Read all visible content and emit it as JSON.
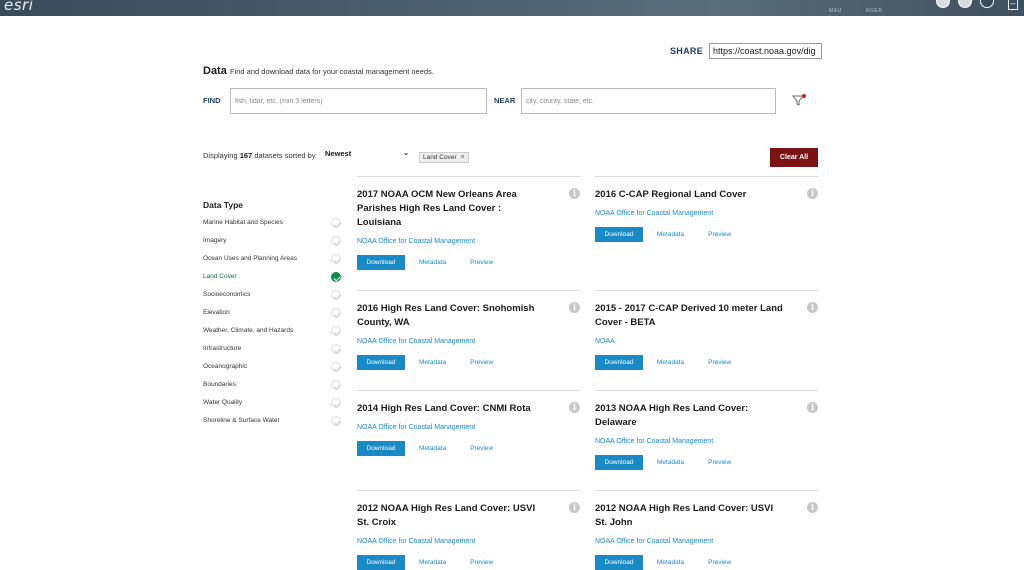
{
  "topbar": {
    "logo": "esri",
    "map_labels": [
      "MAU",
      "NGER"
    ]
  },
  "share": {
    "label": "SHARE",
    "url": "https://coast.noaa.gov/dig"
  },
  "header": {
    "title": "Data",
    "subtitle": "Find and download data for your coastal management needs."
  },
  "search": {
    "find_label": "FIND",
    "find_placeholder": "fish, lidar, etc. (min 3 letters)",
    "near_label": "NEAR",
    "near_placeholder": "city, county, state, etc."
  },
  "results": {
    "prefix": "Displaying",
    "count": "167",
    "suffix": "datasets sorted by",
    "sort_value": "Newest",
    "active_filter": "Land Cover",
    "chip_close": "×",
    "clear_all": "Clear All"
  },
  "sidebar": {
    "title": "Data Type",
    "items": [
      {
        "label": "Marine Habitat and Species",
        "active": false
      },
      {
        "label": "Imagery",
        "active": false
      },
      {
        "label": "Ocean Uses and Planning Areas",
        "active": false
      },
      {
        "label": "Land Cover",
        "active": true
      },
      {
        "label": "Socioeconomics",
        "active": false
      },
      {
        "label": "Elevation",
        "active": false
      },
      {
        "label": "Weather, Climate, and Hazards",
        "active": false
      },
      {
        "label": "Infrastructure",
        "active": false
      },
      {
        "label": "Oceanographic",
        "active": false
      },
      {
        "label": "Boundaries",
        "active": false
      },
      {
        "label": "Water Quality",
        "active": false
      },
      {
        "label": "Shoreline & Surface Water",
        "active": false
      }
    ]
  },
  "actions": {
    "download": "Download",
    "metadata": "Metadata",
    "preview": "Preview",
    "info": "i"
  },
  "cards": [
    {
      "title": "2017 NOAA OCM New Orleans Area Parishes High Res Land Cover : Louisiana",
      "org": "NOAA Office for Coastal Management"
    },
    {
      "title": "2016 C-CAP Regional Land Cover",
      "org": "NOAA Office for Coastal Management"
    },
    {
      "title": "2016 High Res Land Cover: Snohomish County, WA",
      "org": "NOAA Office for Coastal Management"
    },
    {
      "title": "2015 - 2017 C-CAP Derived 10 meter Land Cover - BETA",
      "org": "NOAA"
    },
    {
      "title": "2014 High Res Land Cover: CNMI Rota",
      "org": "NOAA Office for Coastal Management"
    },
    {
      "title": "2013 NOAA High Res Land Cover: Delaware",
      "org": "NOAA Office for Coastal Management"
    },
    {
      "title": "2012 NOAA High Res Land Cover: USVI St. Croix",
      "org": "NOAA Office for Coastal Management"
    },
    {
      "title": "2012 NOAA High Res Land Cover: USVI St. John",
      "org": "NOAA Office for Coastal Management"
    }
  ],
  "colors": {
    "accent": "#1a8ac6",
    "clear_all": "#7a1313",
    "active_green": "#0c8a4b",
    "label_navy": "#1a3b5a"
  }
}
